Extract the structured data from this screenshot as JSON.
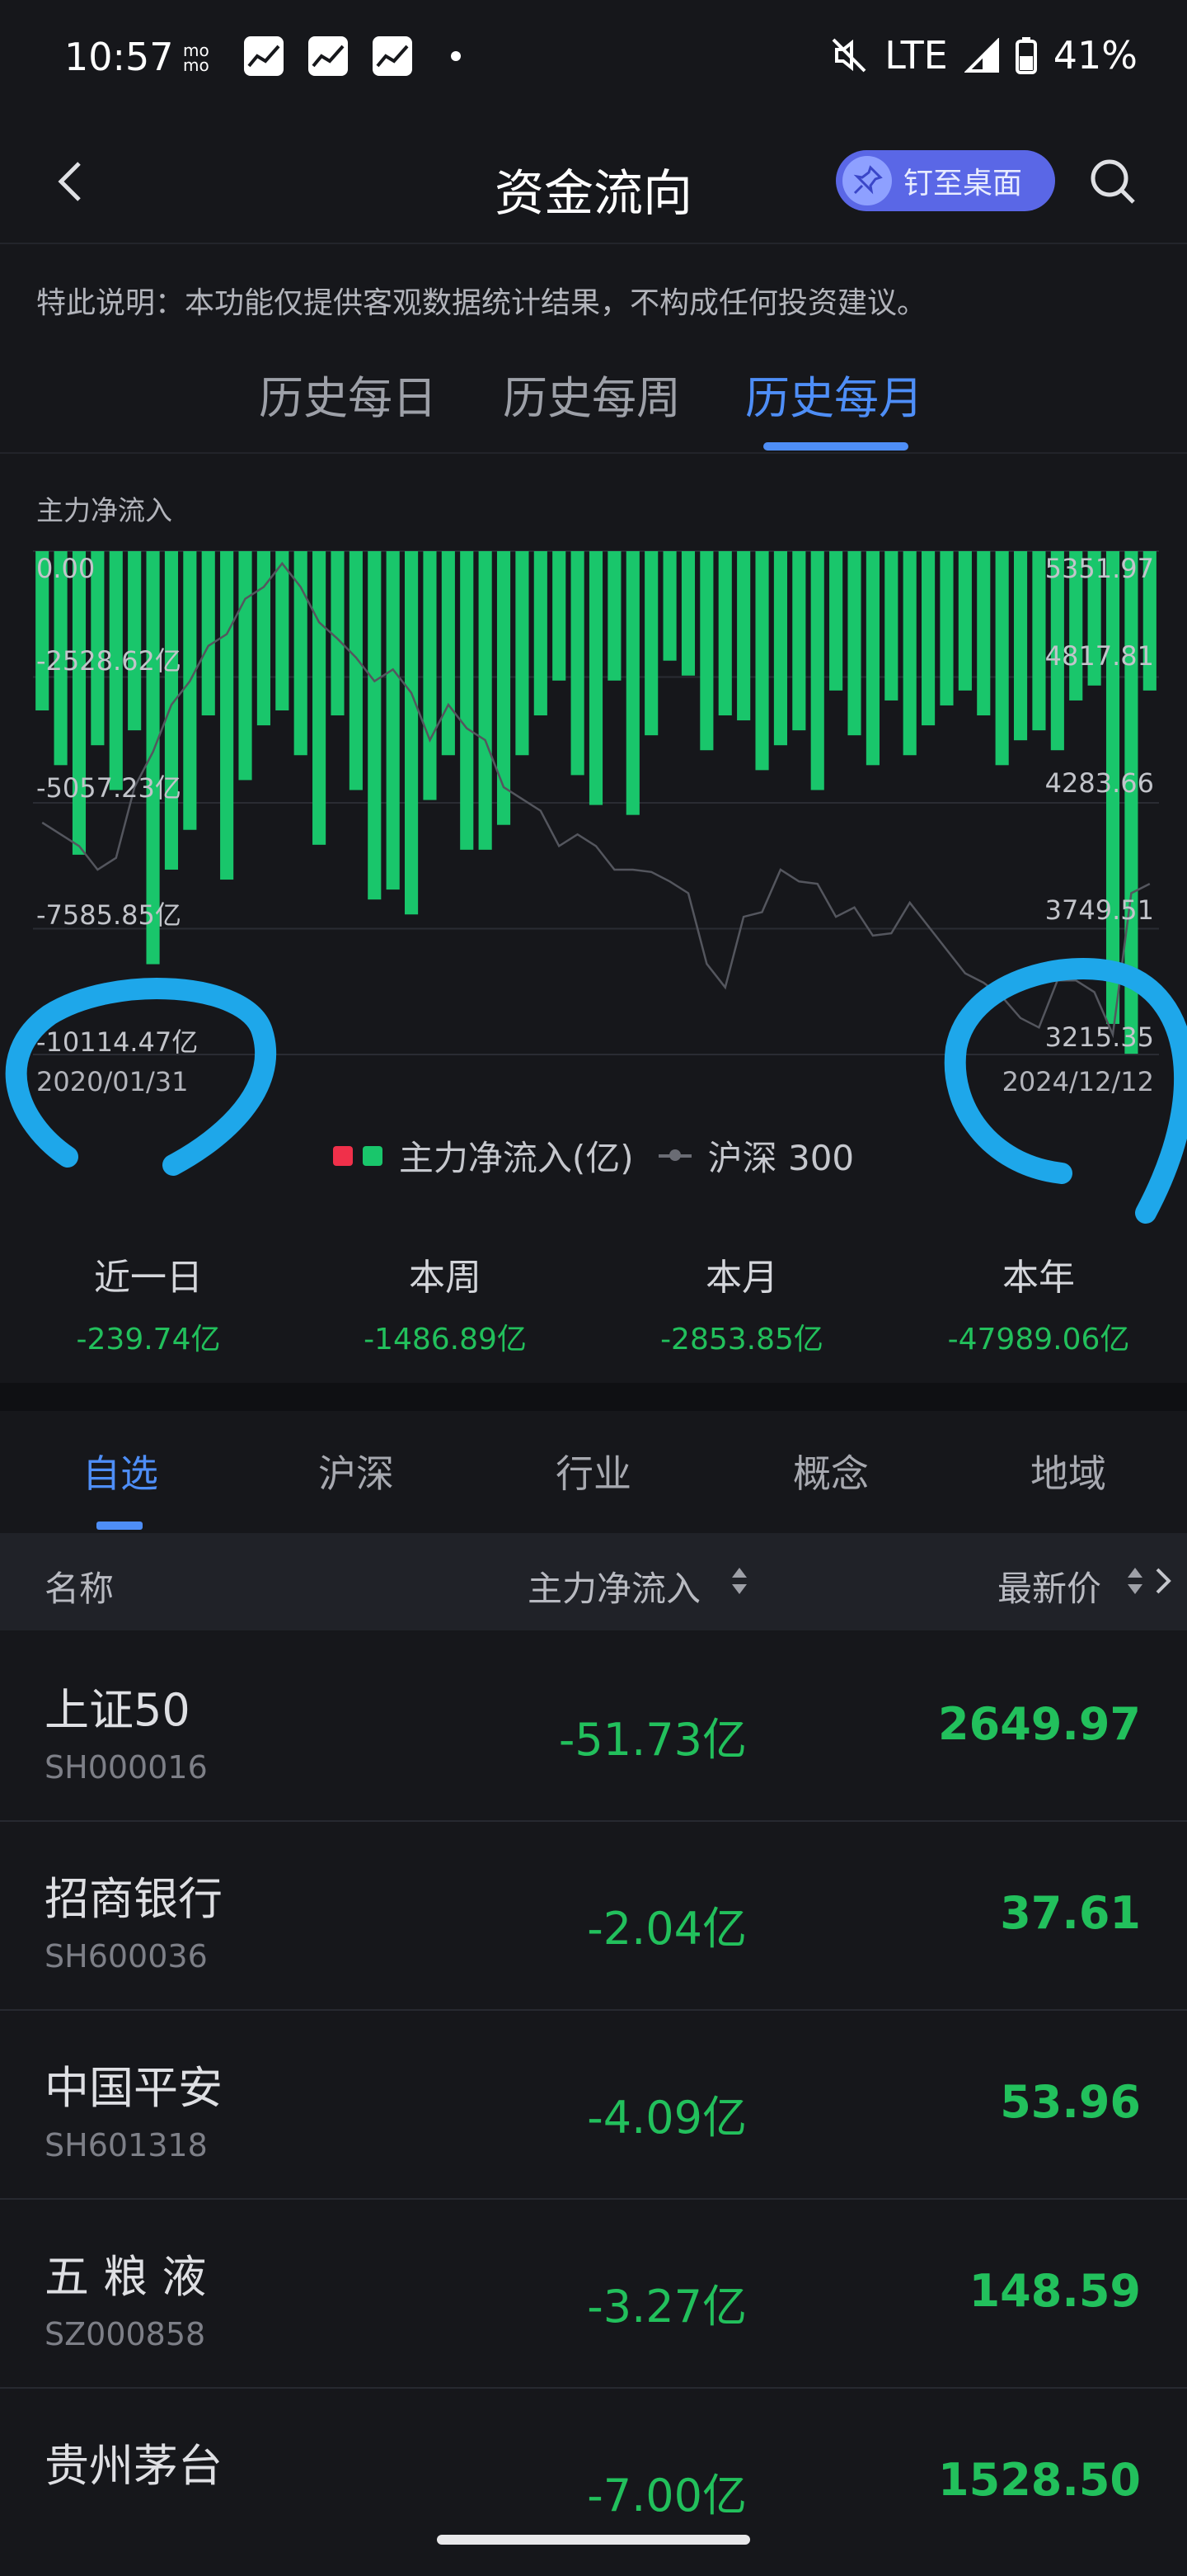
{
  "status_bar": {
    "time": "10:57",
    "network": "LTE",
    "battery": "41%",
    "icons": [
      "mo-icon",
      "stock-app-icon",
      "stock-app-icon",
      "stock-app-icon",
      "dot-icon",
      "mute-icon",
      "signal-icon",
      "battery-icon"
    ]
  },
  "header": {
    "title": "资金流向",
    "pin_label": "钉至桌面"
  },
  "notice": "特此说明：本功能仅提供客观数据统计结果，不构成任何投资建议。",
  "period_tabs": [
    {
      "label": "历史每日",
      "active": false
    },
    {
      "label": "历史每周",
      "active": false
    },
    {
      "label": "历史每月",
      "active": true
    }
  ],
  "chart_data": {
    "type": "bar",
    "title": "主力净流入",
    "left_axis_ticks": [
      "0.00",
      "-2528.62亿",
      "-5057.23亿",
      "-7585.85亿",
      "-10114.47亿"
    ],
    "right_axis_ticks": [
      "5351.97",
      "4817.81",
      "4283.66",
      "3749.51",
      "3215.35"
    ],
    "ylim_left": [
      -10114.47,
      0
    ],
    "ylim_right": [
      3215.35,
      5351.97
    ],
    "x_start": "2020/01/31",
    "x_end": "2024/12/12",
    "colors": {
      "inflow": "#f0304a",
      "outflow": "#19c66b",
      "index_line": "#6a6c74"
    },
    "series": [
      {
        "name": "主力净流入(亿)",
        "values": [
          -3200,
          -4300,
          -6100,
          -3900,
          -4800,
          -3600,
          -8300,
          -6400,
          -5600,
          -3300,
          -6600,
          -4600,
          -3500,
          -3200,
          -4100,
          -5900,
          -3300,
          -4800,
          -7000,
          -6800,
          -7300,
          -5000,
          -4100,
          -6000,
          -6000,
          -5500,
          -4100,
          -3300,
          -2600,
          -4500,
          -5100,
          -2600,
          -5300,
          -3700,
          -2200,
          -2500,
          -4000,
          -3300,
          -3400,
          -4400,
          -3900,
          -3600,
          -4800,
          -2800,
          -3700,
          -4300,
          -3000,
          -4100,
          -3500,
          -3100,
          -2800,
          -3300,
          -4300,
          -3800,
          -3600,
          -4000,
          -3000,
          -2700,
          -9500,
          -10100,
          -2800
        ]
      },
      {
        "name": "沪深 300",
        "values": [
          4200,
          4150,
          4100,
          4000,
          4050,
          4350,
          4500,
          4700,
          4800,
          4950,
          5000,
          5150,
          5200,
          5300,
          5200,
          5050,
          4980,
          4900,
          4800,
          4850,
          4750,
          4550,
          4700,
          4600,
          4550,
          4350,
          4300,
          4250,
          4100,
          4150,
          4100,
          4000,
          4000,
          3990,
          3950,
          3900,
          3600,
          3500,
          3800,
          3820,
          4000,
          3950,
          3940,
          3800,
          3840,
          3720,
          3730,
          3860,
          3760,
          3660,
          3560,
          3520,
          3460,
          3370,
          3330,
          3530,
          3530,
          3480,
          3300,
          3900,
          3940
        ]
      }
    ],
    "legend": [
      "主力净流入(亿)",
      "沪深 300"
    ],
    "grid": true
  },
  "summary": [
    {
      "label": "近一日",
      "value": "-239.74亿"
    },
    {
      "label": "本周",
      "value": "-1486.89亿"
    },
    {
      "label": "本月",
      "value": "-2853.85亿"
    },
    {
      "label": "本年",
      "value": "-47989.06亿"
    }
  ],
  "category_tabs": [
    {
      "label": "自选",
      "active": true
    },
    {
      "label": "沪深",
      "active": false
    },
    {
      "label": "行业",
      "active": false
    },
    {
      "label": "概念",
      "active": false
    },
    {
      "label": "地域",
      "active": false
    }
  ],
  "table": {
    "headers": {
      "name": "名称",
      "flow": "主力净流入",
      "price": "最新价"
    },
    "rows": [
      {
        "name": "上证50",
        "code": "SH000016",
        "flow": "-51.73亿",
        "price": "2649.97"
      },
      {
        "name": "招商银行",
        "code": "SH600036",
        "flow": "-2.04亿",
        "price": "37.61"
      },
      {
        "name": "中国平安",
        "code": "SH601318",
        "flow": "-4.09亿",
        "price": "53.96"
      },
      {
        "name": "五 粮 液",
        "code": "SZ000858",
        "flow": "-3.27亿",
        "price": "148.59"
      },
      {
        "name": "贵州茅台",
        "code": "",
        "flow": "-7.00亿",
        "price": "1528.50"
      }
    ]
  }
}
